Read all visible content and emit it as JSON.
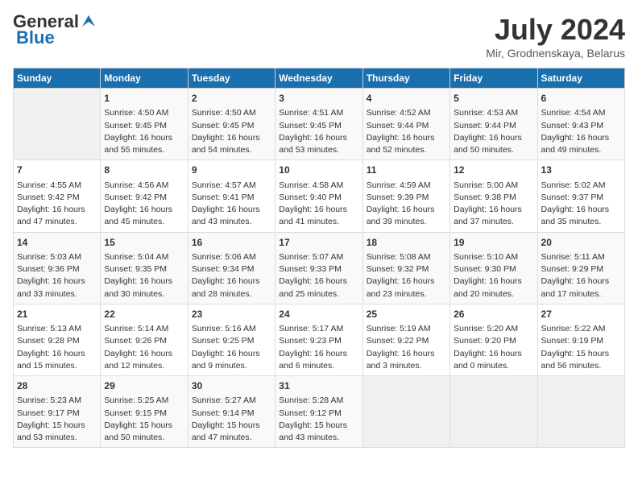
{
  "header": {
    "logo_line1": "General",
    "logo_line2": "Blue",
    "month": "July 2024",
    "location": "Mir, Grodnenskaya, Belarus"
  },
  "days_of_week": [
    "Sunday",
    "Monday",
    "Tuesday",
    "Wednesday",
    "Thursday",
    "Friday",
    "Saturday"
  ],
  "weeks": [
    [
      {
        "day": "",
        "content": ""
      },
      {
        "day": "1",
        "content": "Sunrise: 4:50 AM\nSunset: 9:45 PM\nDaylight: 16 hours\nand 55 minutes."
      },
      {
        "day": "2",
        "content": "Sunrise: 4:50 AM\nSunset: 9:45 PM\nDaylight: 16 hours\nand 54 minutes."
      },
      {
        "day": "3",
        "content": "Sunrise: 4:51 AM\nSunset: 9:45 PM\nDaylight: 16 hours\nand 53 minutes."
      },
      {
        "day": "4",
        "content": "Sunrise: 4:52 AM\nSunset: 9:44 PM\nDaylight: 16 hours\nand 52 minutes."
      },
      {
        "day": "5",
        "content": "Sunrise: 4:53 AM\nSunset: 9:44 PM\nDaylight: 16 hours\nand 50 minutes."
      },
      {
        "day": "6",
        "content": "Sunrise: 4:54 AM\nSunset: 9:43 PM\nDaylight: 16 hours\nand 49 minutes."
      }
    ],
    [
      {
        "day": "7",
        "content": "Sunrise: 4:55 AM\nSunset: 9:42 PM\nDaylight: 16 hours\nand 47 minutes."
      },
      {
        "day": "8",
        "content": "Sunrise: 4:56 AM\nSunset: 9:42 PM\nDaylight: 16 hours\nand 45 minutes."
      },
      {
        "day": "9",
        "content": "Sunrise: 4:57 AM\nSunset: 9:41 PM\nDaylight: 16 hours\nand 43 minutes."
      },
      {
        "day": "10",
        "content": "Sunrise: 4:58 AM\nSunset: 9:40 PM\nDaylight: 16 hours\nand 41 minutes."
      },
      {
        "day": "11",
        "content": "Sunrise: 4:59 AM\nSunset: 9:39 PM\nDaylight: 16 hours\nand 39 minutes."
      },
      {
        "day": "12",
        "content": "Sunrise: 5:00 AM\nSunset: 9:38 PM\nDaylight: 16 hours\nand 37 minutes."
      },
      {
        "day": "13",
        "content": "Sunrise: 5:02 AM\nSunset: 9:37 PM\nDaylight: 16 hours\nand 35 minutes."
      }
    ],
    [
      {
        "day": "14",
        "content": "Sunrise: 5:03 AM\nSunset: 9:36 PM\nDaylight: 16 hours\nand 33 minutes."
      },
      {
        "day": "15",
        "content": "Sunrise: 5:04 AM\nSunset: 9:35 PM\nDaylight: 16 hours\nand 30 minutes."
      },
      {
        "day": "16",
        "content": "Sunrise: 5:06 AM\nSunset: 9:34 PM\nDaylight: 16 hours\nand 28 minutes."
      },
      {
        "day": "17",
        "content": "Sunrise: 5:07 AM\nSunset: 9:33 PM\nDaylight: 16 hours\nand 25 minutes."
      },
      {
        "day": "18",
        "content": "Sunrise: 5:08 AM\nSunset: 9:32 PM\nDaylight: 16 hours\nand 23 minutes."
      },
      {
        "day": "19",
        "content": "Sunrise: 5:10 AM\nSunset: 9:30 PM\nDaylight: 16 hours\nand 20 minutes."
      },
      {
        "day": "20",
        "content": "Sunrise: 5:11 AM\nSunset: 9:29 PM\nDaylight: 16 hours\nand 17 minutes."
      }
    ],
    [
      {
        "day": "21",
        "content": "Sunrise: 5:13 AM\nSunset: 9:28 PM\nDaylight: 16 hours\nand 15 minutes."
      },
      {
        "day": "22",
        "content": "Sunrise: 5:14 AM\nSunset: 9:26 PM\nDaylight: 16 hours\nand 12 minutes."
      },
      {
        "day": "23",
        "content": "Sunrise: 5:16 AM\nSunset: 9:25 PM\nDaylight: 16 hours\nand 9 minutes."
      },
      {
        "day": "24",
        "content": "Sunrise: 5:17 AM\nSunset: 9:23 PM\nDaylight: 16 hours\nand 6 minutes."
      },
      {
        "day": "25",
        "content": "Sunrise: 5:19 AM\nSunset: 9:22 PM\nDaylight: 16 hours\nand 3 minutes."
      },
      {
        "day": "26",
        "content": "Sunrise: 5:20 AM\nSunset: 9:20 PM\nDaylight: 16 hours\nand 0 minutes."
      },
      {
        "day": "27",
        "content": "Sunrise: 5:22 AM\nSunset: 9:19 PM\nDaylight: 15 hours\nand 56 minutes."
      }
    ],
    [
      {
        "day": "28",
        "content": "Sunrise: 5:23 AM\nSunset: 9:17 PM\nDaylight: 15 hours\nand 53 minutes."
      },
      {
        "day": "29",
        "content": "Sunrise: 5:25 AM\nSunset: 9:15 PM\nDaylight: 15 hours\nand 50 minutes."
      },
      {
        "day": "30",
        "content": "Sunrise: 5:27 AM\nSunset: 9:14 PM\nDaylight: 15 hours\nand 47 minutes."
      },
      {
        "day": "31",
        "content": "Sunrise: 5:28 AM\nSunset: 9:12 PM\nDaylight: 15 hours\nand 43 minutes."
      },
      {
        "day": "",
        "content": ""
      },
      {
        "day": "",
        "content": ""
      },
      {
        "day": "",
        "content": ""
      }
    ]
  ]
}
